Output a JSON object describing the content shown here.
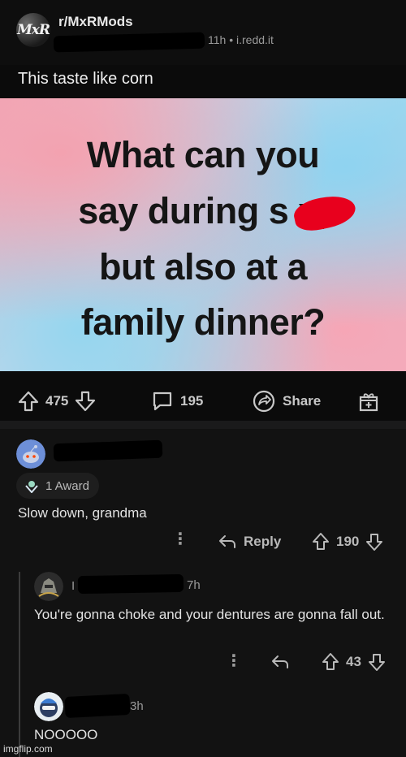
{
  "post": {
    "subreddit": "r/MxRMods",
    "subreddit_avatar_text": "MxR",
    "time_source": "11h • i.redd.it",
    "title": "This taste like corn",
    "meme_lines": [
      "What can you",
      "say during s  x,",
      "but also at a",
      "family dinner?"
    ],
    "upvotes": "475",
    "comments": "195",
    "share_label": "Share"
  },
  "comments": [
    {
      "award_label": "1 Award",
      "text": "Slow down, grandma",
      "reply_label": "Reply",
      "score": "190"
    },
    {
      "meta_prefix": "I",
      "time": "7h",
      "text": "You're gonna choke and your dentures are gonna fall out.",
      "score": "43"
    },
    {
      "time": "3h",
      "text": "NOOOOO"
    }
  ],
  "watermark": "imgflip.com",
  "colors": {
    "background": "#0b0b0b",
    "comment_bg": "#121212",
    "redaction": "#000000",
    "scribble": "#e8001d"
  }
}
